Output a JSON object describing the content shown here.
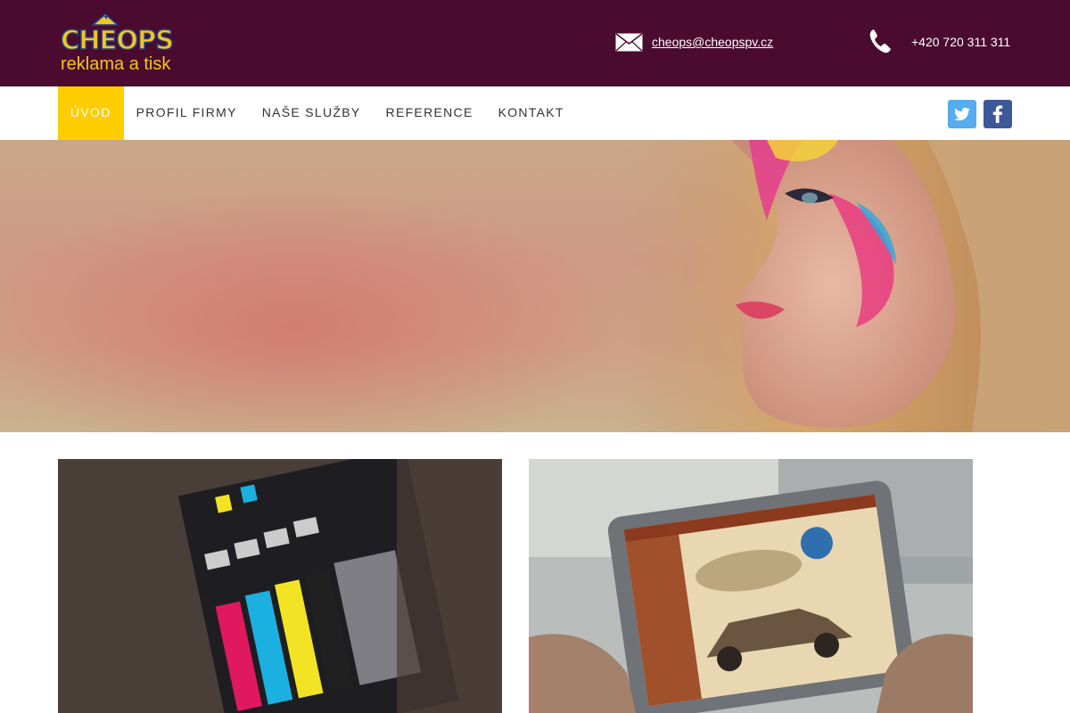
{
  "header": {
    "logo": {
      "brand": "CHEOPS",
      "tagline": "reklama a tisk"
    },
    "email": "cheops@cheopspv.cz",
    "phone": "+420 720 311 311"
  },
  "nav": {
    "items": [
      {
        "label": "ÚVOD",
        "active": true
      },
      {
        "label": "PROFIL FIRMY"
      },
      {
        "label": "NAŠE SLUŽBY"
      },
      {
        "label": "REFERENCE"
      },
      {
        "label": "KONTAKT"
      }
    ]
  },
  "social": {
    "twitter": "twitter-icon",
    "facebook": "facebook-icon"
  },
  "colors": {
    "topbar": "#4a0b2e",
    "accent": "#ffcc00",
    "logo_yellow": "#f4c51b",
    "twitter": "#55acee",
    "facebook": "#3b5998"
  },
  "hero": {
    "image": "woman-colorful-face-paint-photo"
  },
  "cards": [
    {
      "image": "printer-ink-cartridges-photo"
    },
    {
      "image": "tablet-vintage-car-website-photo"
    }
  ]
}
